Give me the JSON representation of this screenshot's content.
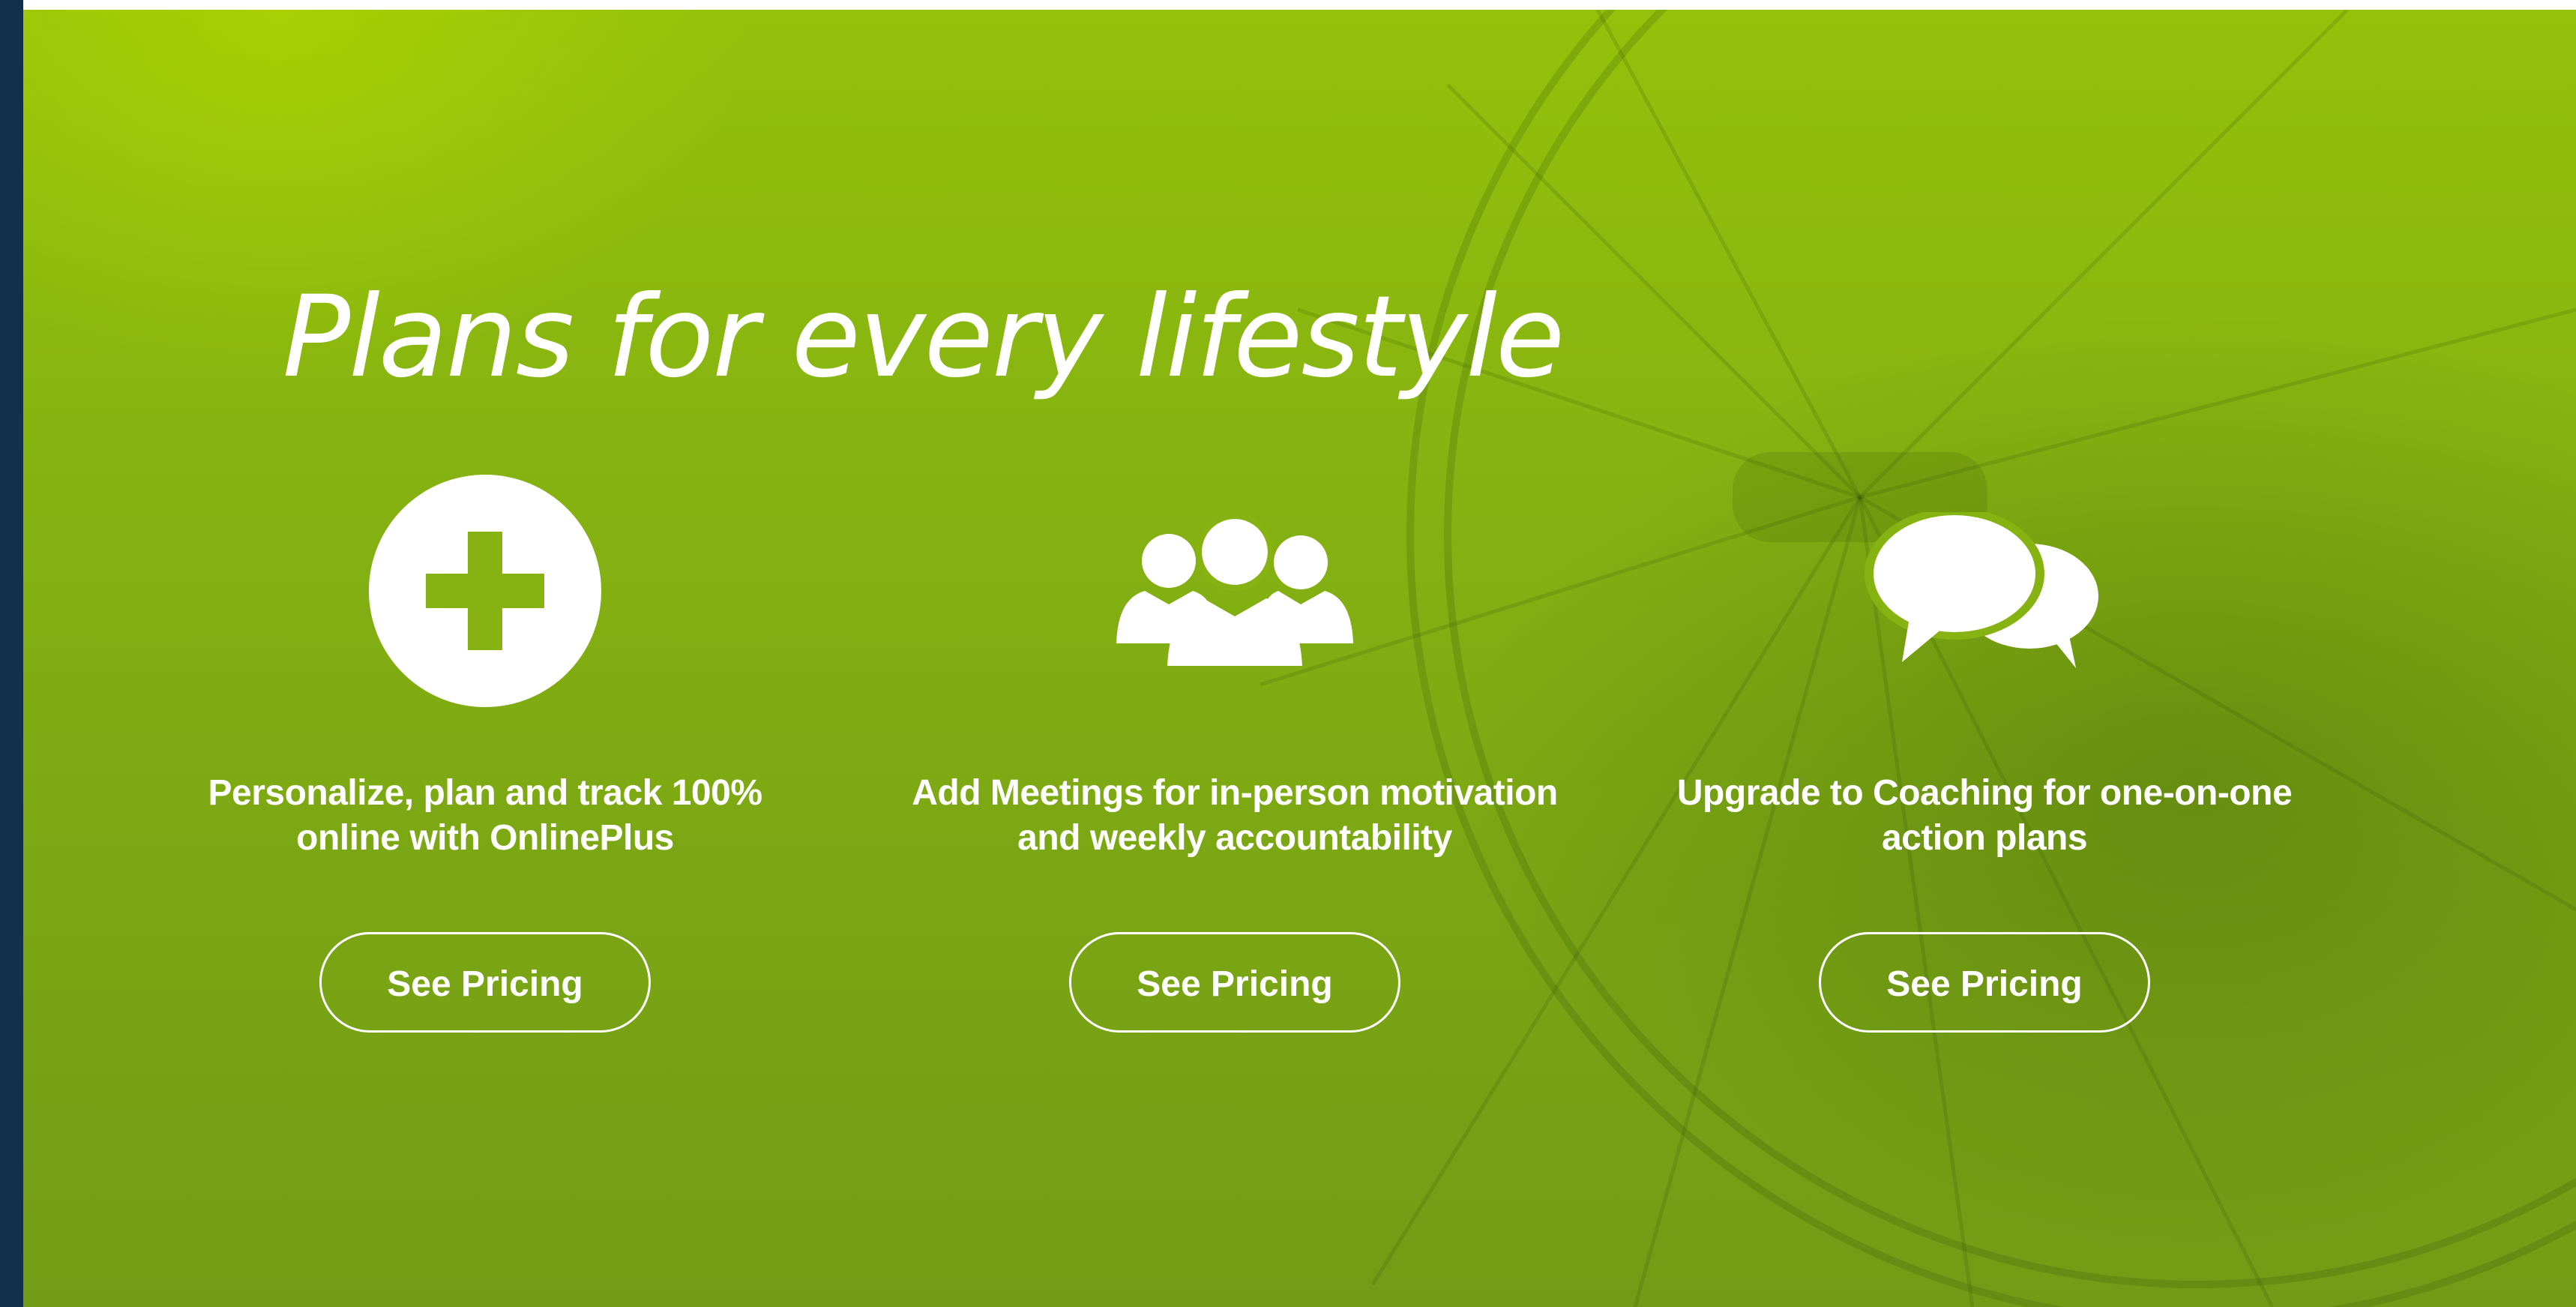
{
  "hero": {
    "title": "Plans for every lifestyle",
    "background_color": "#86b311",
    "plans": [
      {
        "icon": "plus-circle-icon",
        "description_line1": "Personalize, plan and track 100%",
        "description_line2": "online with OnlinePlus",
        "button_label": "See Pricing"
      },
      {
        "icon": "group-people-icon",
        "description_line1": "Add Meetings for in-person motivation",
        "description_line2": "and weekly accountability",
        "button_label": "See Pricing"
      },
      {
        "icon": "chat-bubbles-icon",
        "description_line1": "Upgrade to Coaching for one-on-one",
        "description_line2": "action plans",
        "button_label": "See Pricing"
      }
    ]
  }
}
